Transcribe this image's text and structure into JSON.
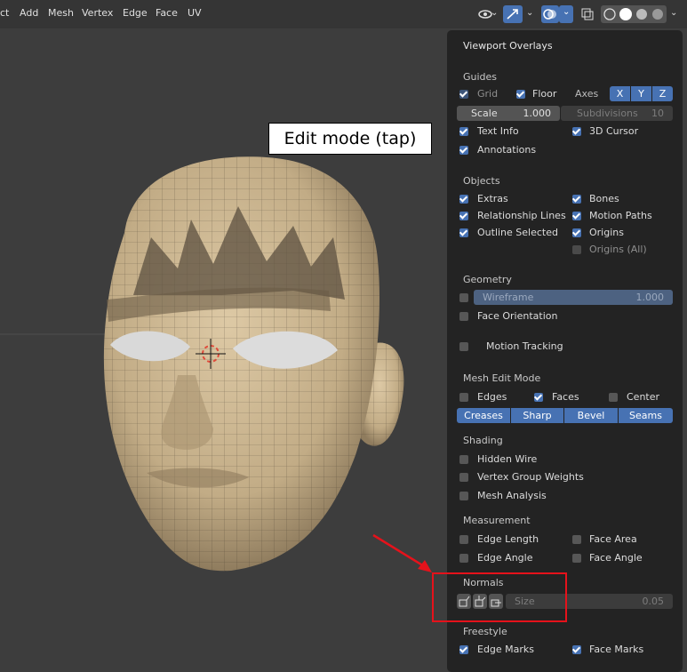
{
  "menu": {
    "items": [
      "ct",
      "Add",
      "Mesh",
      "Vertex",
      "Edge",
      "Face",
      "UV"
    ]
  },
  "viewport": {
    "label": "Edit mode (tap)"
  },
  "overlay": {
    "title": "Viewport Overlays",
    "guides": {
      "title": "Guides",
      "grid": "Grid",
      "floor": "Floor",
      "axes": "Axes",
      "x": "X",
      "y": "Y",
      "z": "Z",
      "scale_label": "Scale",
      "scale_value": "1.000",
      "subdiv_label": "Subdivisions",
      "subdiv_value": "10",
      "text_info": "Text Info",
      "cursor": "3D Cursor",
      "annotations": "Annotations"
    },
    "objects": {
      "title": "Objects",
      "extras": "Extras",
      "bones": "Bones",
      "relationship": "Relationship Lines",
      "motion_paths": "Motion Paths",
      "outline": "Outline Selected",
      "origins": "Origins",
      "origins_all": "Origins (All)"
    },
    "geometry": {
      "title": "Geometry",
      "wireframe": "Wireframe",
      "wireframe_value": "1.000",
      "face_orientation": "Face Orientation",
      "motion_tracking": "Motion Tracking"
    },
    "mesh_edit": {
      "title": "Mesh Edit Mode",
      "edges": "Edges",
      "faces": "Faces",
      "center": "Center",
      "creases": "Creases",
      "sharp": "Sharp",
      "bevel": "Bevel",
      "seams": "Seams"
    },
    "shading": {
      "title": "Shading",
      "hidden_wire": "Hidden Wire",
      "vertex_group": "Vertex Group Weights",
      "mesh_analysis": "Mesh Analysis"
    },
    "measurement": {
      "title": "Measurement",
      "edge_length": "Edge Length",
      "face_area": "Face Area",
      "edge_angle": "Edge Angle",
      "face_angle": "Face Angle"
    },
    "normals": {
      "title": "Normals",
      "size_label": "Size",
      "size_value": "0.05"
    },
    "freestyle": {
      "title": "Freestyle",
      "edge_marks": "Edge Marks",
      "face_marks": "Face Marks"
    }
  }
}
